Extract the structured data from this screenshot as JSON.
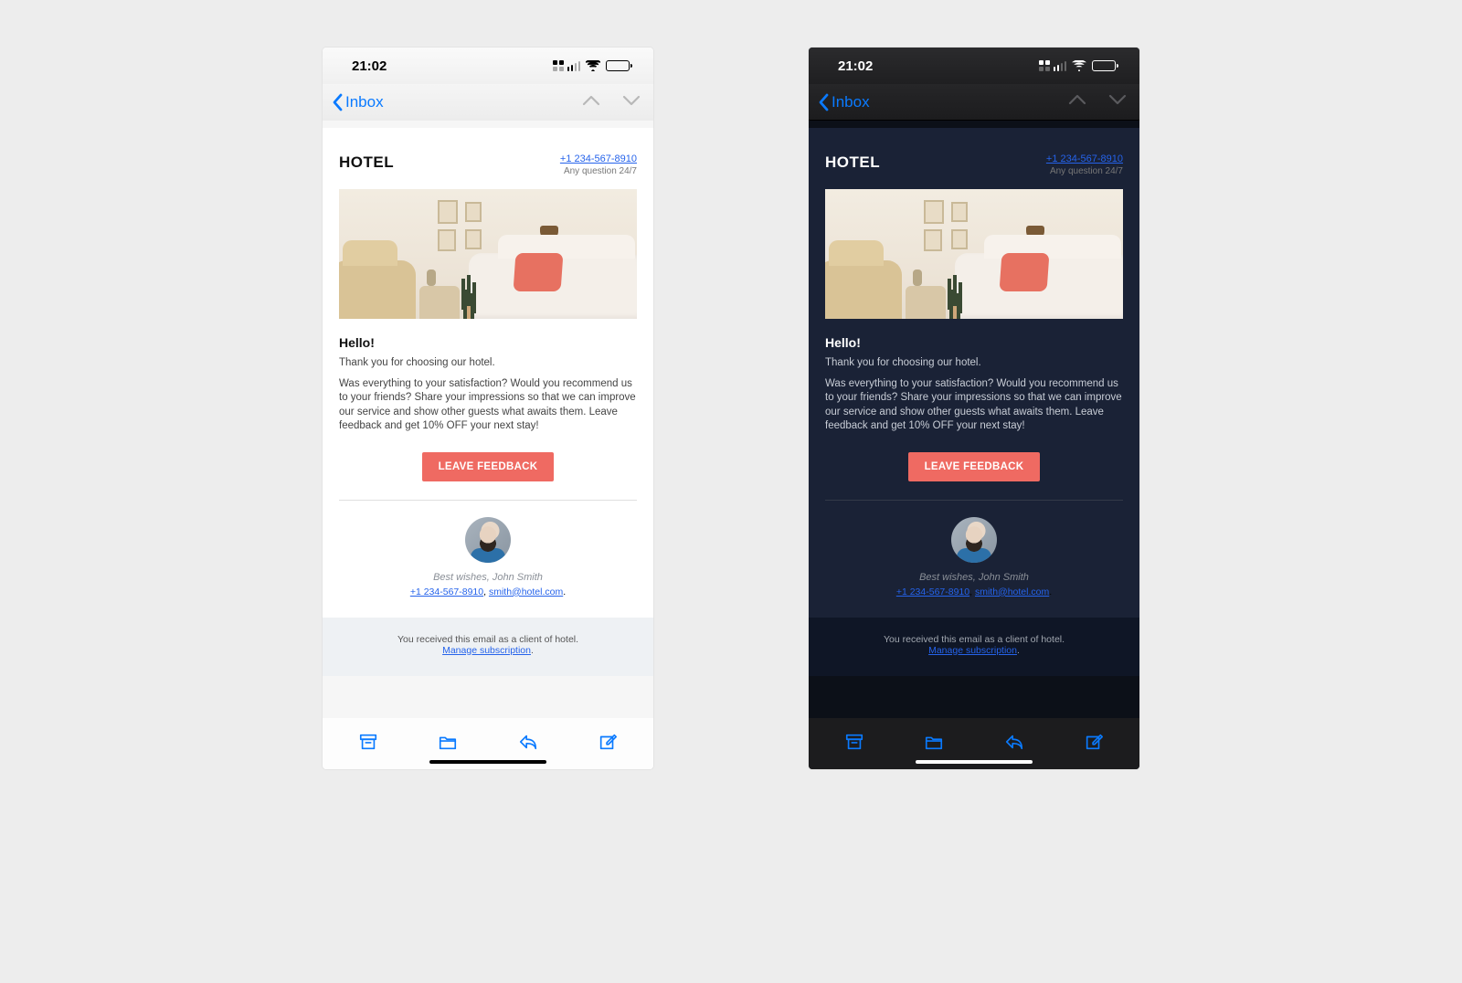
{
  "statusbar": {
    "time": "21:02"
  },
  "navbar": {
    "back_label": "Inbox"
  },
  "email": {
    "brand": "HOTEL",
    "phone": "+1 234-567-8910",
    "phone_subtitle": "Any question 24/7",
    "greeting": "Hello!",
    "thanks": "Thank you for choosing our hotel.",
    "body": "Was everything to your satisfaction? Would you recommend us to your friends? Share your impressions so that we can improve our service and show other guests what awaits them. Leave feedback and get 10% OFF your next stay!",
    "cta_label": "LEAVE FEEDBACK",
    "signature": "Best wishes, John Smith",
    "contact_phone": "+1 234-567-8910",
    "contact_separator": ", ",
    "contact_email": "smith@hotel.com",
    "contact_period": ".",
    "footer_line": "You received this email as a client of hotel.",
    "manage_link": "Manage subscription",
    "footer_period": "."
  },
  "colors": {
    "accent": "#0a7aff",
    "cta": "#ef6a62",
    "link": "#2563eb"
  }
}
